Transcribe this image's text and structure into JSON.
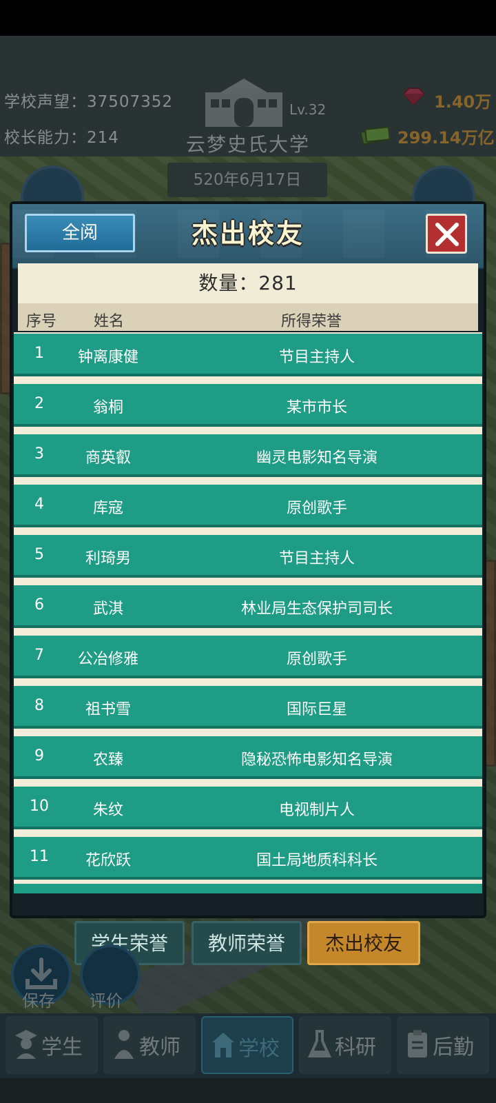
{
  "background": {
    "reputation": "学校声望：37507352",
    "ability": "校长能力：214",
    "gems": "1.40万",
    "money": "299.14万亿",
    "level": "Lv.32",
    "school_name": "云梦史氏大学",
    "date": "520年6月17日",
    "save_label": "保存",
    "rate_label": "评价"
  },
  "modal": {
    "read_all_label": "全阅",
    "title": "杰出校友",
    "count_text": "数量：281",
    "columns": {
      "num": "序号",
      "name": "姓名",
      "honor": "所得荣誉"
    },
    "rows": [
      {
        "num": "1",
        "name": "钟离康健",
        "honor": "节目主持人"
      },
      {
        "num": "2",
        "name": "翁桐",
        "honor": "某市市长"
      },
      {
        "num": "3",
        "name": "商英叡",
        "honor": "幽灵电影知名导演"
      },
      {
        "num": "4",
        "name": "库寇",
        "honor": "原创歌手"
      },
      {
        "num": "5",
        "name": "利琦男",
        "honor": "节目主持人"
      },
      {
        "num": "6",
        "name": "武淇",
        "honor": "林业局生态保护司司长"
      },
      {
        "num": "7",
        "name": "公冶修雅",
        "honor": "原创歌手"
      },
      {
        "num": "8",
        "name": "祖书雪",
        "honor": "国际巨星"
      },
      {
        "num": "9",
        "name": "农臻",
        "honor": "隐秘恐怖电影知名导演"
      },
      {
        "num": "10",
        "name": "朱纹",
        "honor": "电视制片人"
      },
      {
        "num": "11",
        "name": "花欣跃",
        "honor": "国土局地质科科长"
      }
    ]
  },
  "tabs": [
    {
      "label": "学生荣誉"
    },
    {
      "label": "教师荣誉"
    },
    {
      "label": "杰出校友"
    }
  ],
  "nav": [
    {
      "label": "学生"
    },
    {
      "label": "教师"
    },
    {
      "label": "学校"
    },
    {
      "label": "科研"
    },
    {
      "label": "后勤"
    }
  ]
}
